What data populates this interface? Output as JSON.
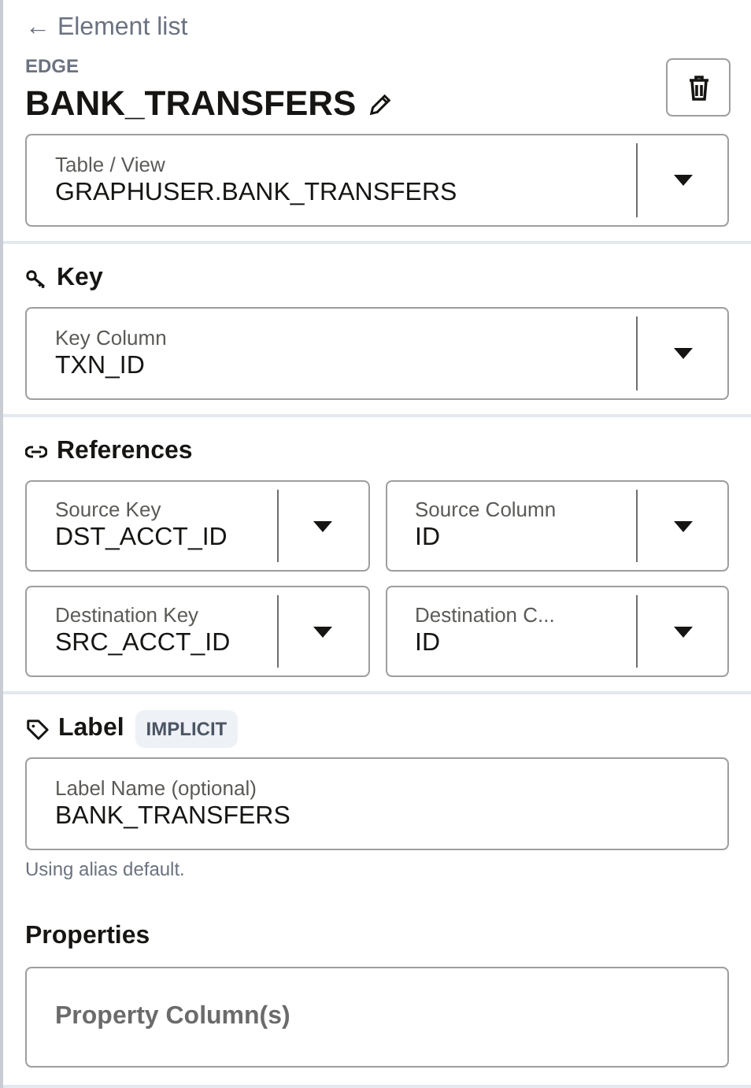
{
  "back_link": "← Element list",
  "element_type": "EDGE",
  "title": "BANK_TRANSFERS",
  "table_select": {
    "label": "Table / View",
    "value": "GRAPHUSER.BANK_TRANSFERS"
  },
  "key_section": {
    "heading": "Key",
    "select": {
      "label": "Key Column",
      "value": "TXN_ID"
    }
  },
  "references_section": {
    "heading": "References",
    "selects": [
      {
        "label": "Source Key",
        "value": "DST_ACCT_ID"
      },
      {
        "label": "Source Column",
        "value": "ID"
      },
      {
        "label": "Destination Key",
        "value": "SRC_ACCT_ID"
      },
      {
        "label": "Destination C...",
        "value": "ID"
      }
    ]
  },
  "label_section": {
    "heading": "Label",
    "badge": "IMPLICIT",
    "field": {
      "label": "Label Name (optional)",
      "value": "BANK_TRANSFERS"
    },
    "helper": "Using alias default."
  },
  "properties_section": {
    "heading": "Properties",
    "field": {
      "placeholder": "Property Column(s)"
    }
  }
}
